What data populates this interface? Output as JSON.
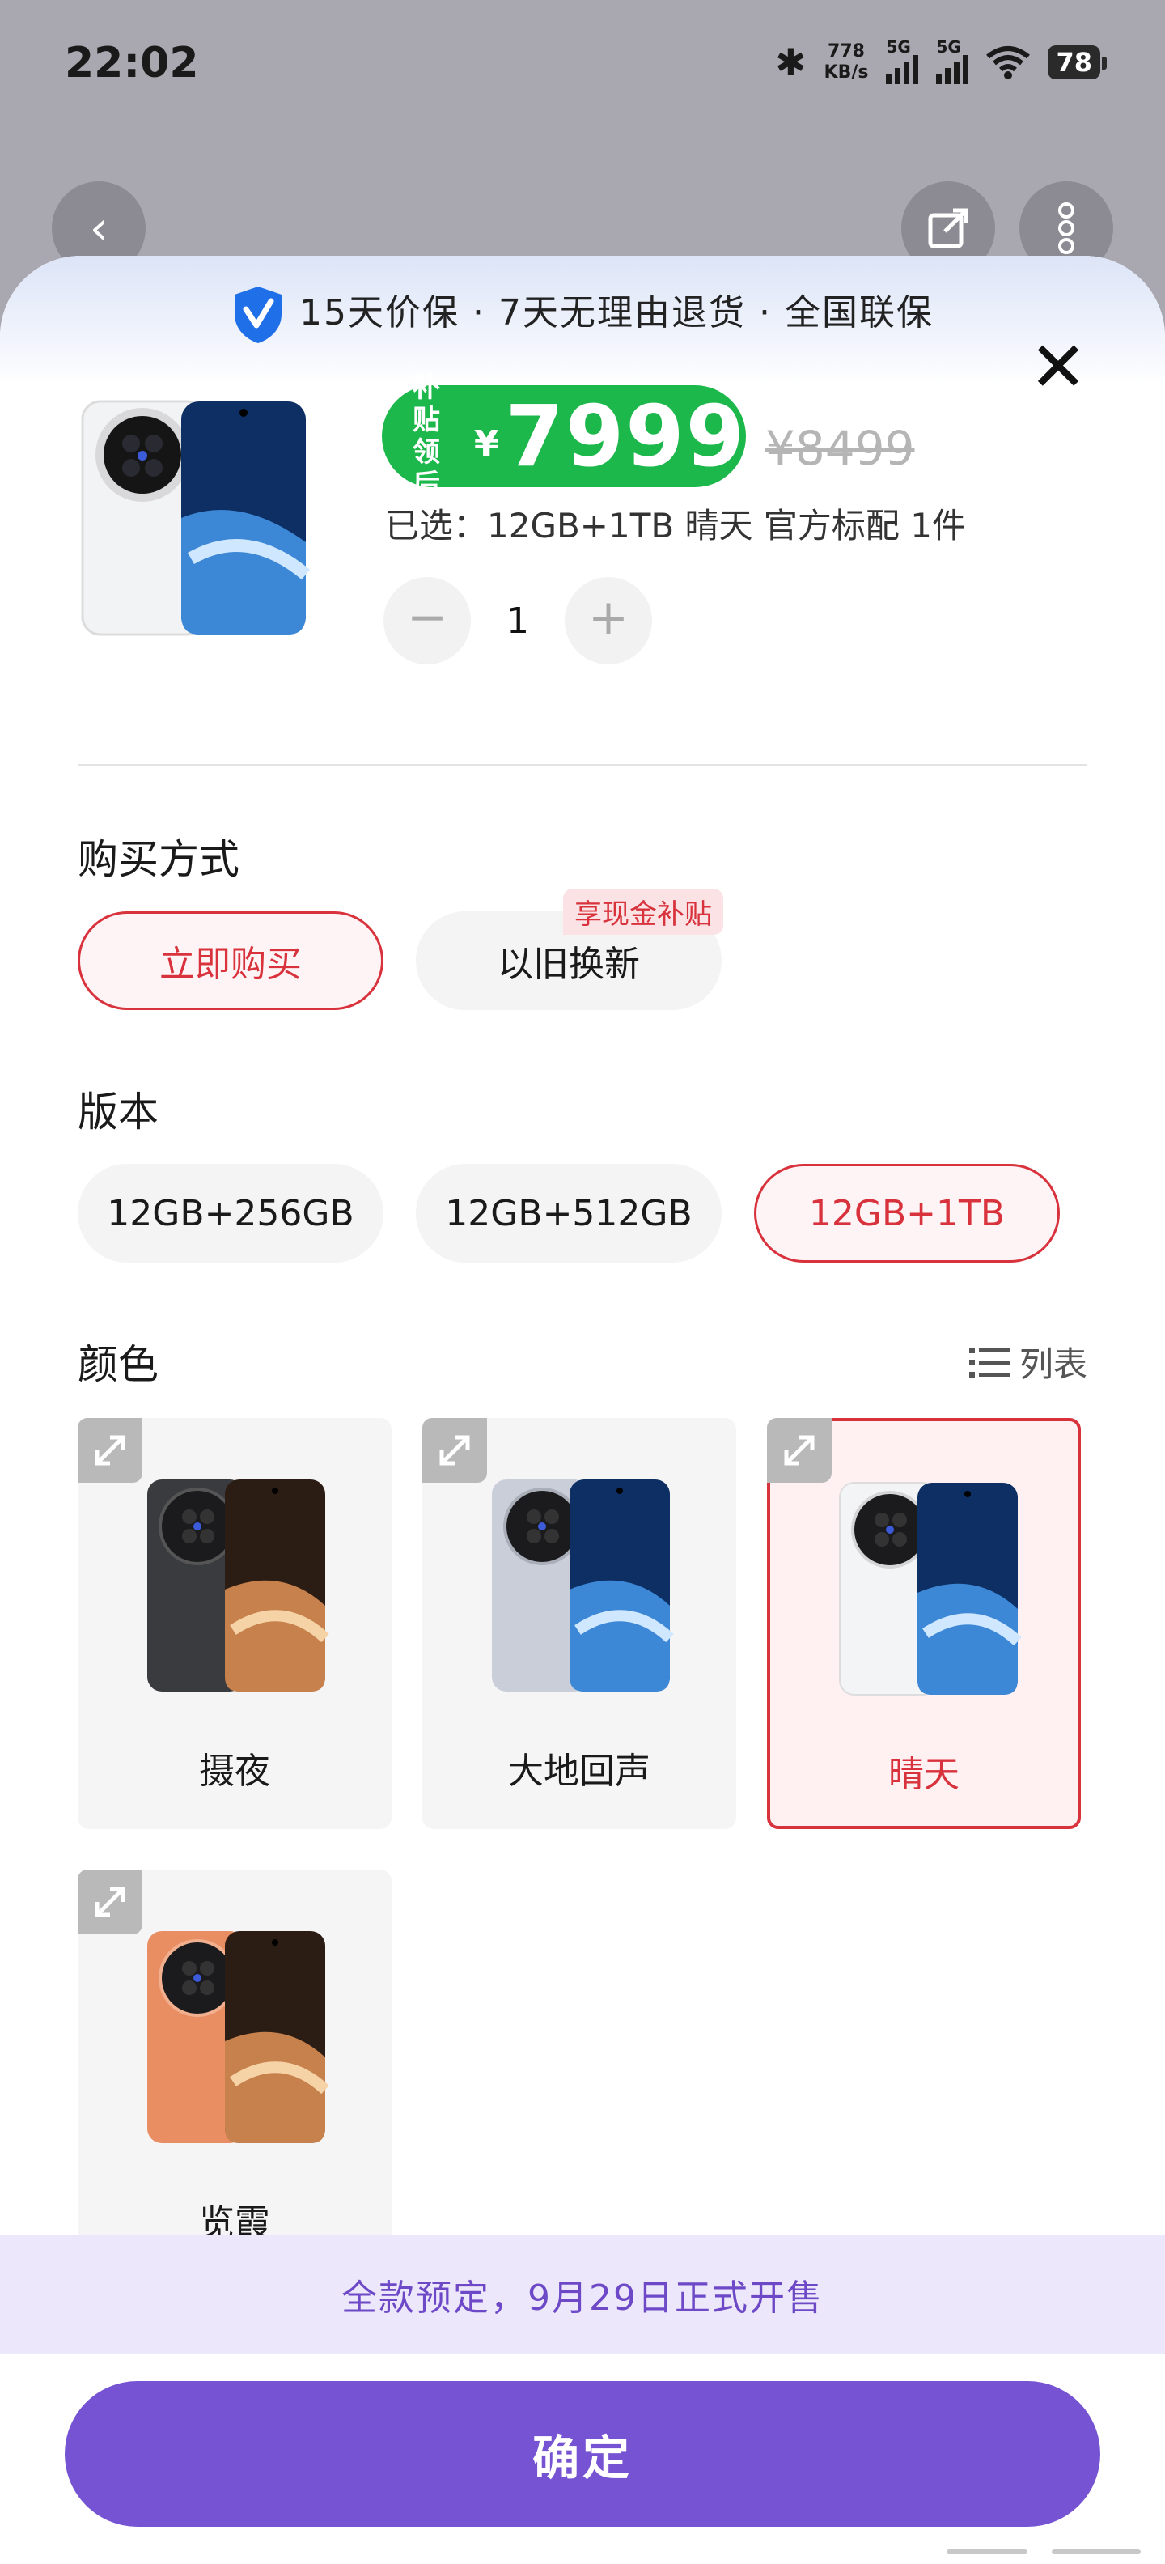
{
  "status_bar": {
    "time": "22:02",
    "net_speed_value": "778",
    "net_speed_unit": "KB/s",
    "sim1": "5G",
    "sim2": "5G",
    "battery": "78"
  },
  "guarantee": {
    "text": "15天价保 · 7天无理由退货 · 全国联保"
  },
  "product": {
    "subsidy_tag_line1": "补贴",
    "subsidy_tag_line2": "领后",
    "currency": "¥",
    "price": "7999",
    "original_price": "¥8499",
    "selected_summary": "已选：12GB+1TB 晴天 官方标配 1件",
    "quantity": "1",
    "minus": "−",
    "plus": "+"
  },
  "purchase": {
    "title": "购买方式",
    "options": [
      {
        "label": "立即购买",
        "selected": true
      },
      {
        "label": "以旧换新",
        "selected": false,
        "badge": "享现金补贴"
      }
    ]
  },
  "version": {
    "title": "版本",
    "options": [
      {
        "label": "12GB+256GB",
        "selected": false
      },
      {
        "label": "12GB+512GB",
        "selected": false
      },
      {
        "label": "12GB+1TB",
        "selected": true
      }
    ]
  },
  "color": {
    "title": "颜色",
    "list_label": "列表",
    "options": [
      {
        "label": "摄夜",
        "selected": false,
        "body_color": "#3a3b3e"
      },
      {
        "label": "大地回声",
        "selected": false,
        "body_color": "#c9ced8"
      },
      {
        "label": "晴天",
        "selected": true,
        "body_color": "#f3f4f6"
      },
      {
        "label": "览霞",
        "selected": false,
        "body_color": "#e98d62"
      }
    ]
  },
  "presale_notice": "全款预定，9月29日正式开售",
  "confirm_label": "确定",
  "colors": {
    "accent_red": "#d8323c",
    "price_green": "#1cb84b",
    "primary_purple": "#7553d2"
  }
}
